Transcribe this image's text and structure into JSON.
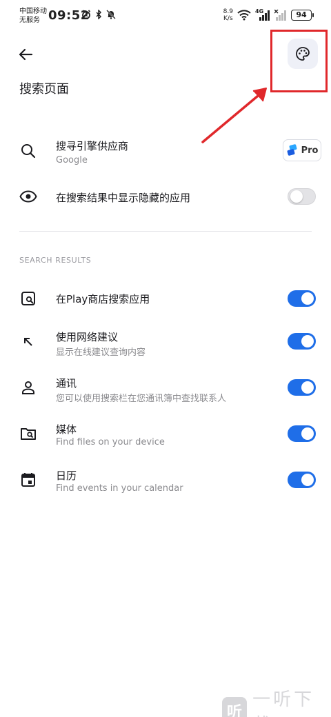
{
  "status_bar": {
    "carrier_line1": "中国移动",
    "carrier_line2": "无服务",
    "time": "09:52",
    "speed_value": "8.9",
    "speed_unit": "K/s",
    "network": "4G",
    "battery": "94"
  },
  "header": {
    "title": "搜索页面"
  },
  "provider": {
    "title": "搜寻引擎供应商",
    "subtitle": "Google",
    "badge_label": "Pro"
  },
  "show_hidden": {
    "title": "在搜索结果中显示隐藏的应用",
    "enabled": false
  },
  "section": {
    "header": "SEARCH RESULTS"
  },
  "results": [
    {
      "icon": "store-search-icon",
      "title": "在Play商店搜索应用",
      "subtitle": "",
      "enabled": true
    },
    {
      "icon": "arrow-up-left-icon",
      "title": "使用网络建议",
      "subtitle": "显示在线建议查询内容",
      "enabled": true
    },
    {
      "icon": "person-icon",
      "title": "通讯",
      "subtitle": "您可以使用搜索栏在您通讯簿中查找联系人",
      "enabled": true
    },
    {
      "icon": "folder-search-icon",
      "title": "媒体",
      "subtitle": "Find files on your device",
      "enabled": true
    },
    {
      "icon": "calendar-icon",
      "title": "日历",
      "subtitle": "Find events in your calendar",
      "enabled": true
    }
  ],
  "watermark": {
    "logo": "听",
    "text": "一听下载"
  },
  "colors": {
    "accent": "#1f6ee8",
    "annotation": "#e0282b"
  }
}
